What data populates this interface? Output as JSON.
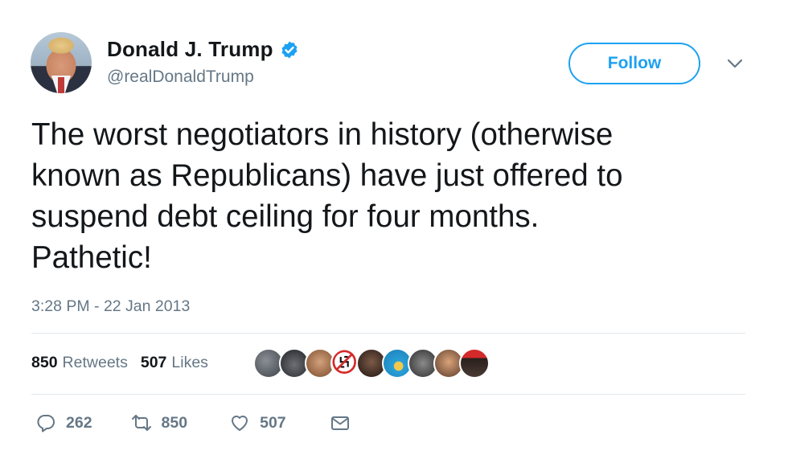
{
  "author": {
    "name": "Donald J. Trump",
    "handle": "@realDonaldTrump",
    "verified": true
  },
  "follow_label": "Follow",
  "tweet": {
    "text": "The worst negotiators in history (otherwise\nknown as Republicans) have just offered to\nsuspend debt ceiling for four months.\nPathetic!",
    "timestamp": "3:28 PM - 22 Jan 2013"
  },
  "stats": {
    "retweets_count": "850",
    "retweets_label": "Retweets",
    "likes_count": "507",
    "likes_label": "Likes"
  },
  "actions": {
    "replies": "262",
    "retweets": "850",
    "likes": "507"
  },
  "colors": {
    "accent": "#1da1f2",
    "text": "#14171a",
    "muted": "#657786",
    "divider": "#e1e8ed"
  },
  "liker_avatars": [
    "liker-avatar-1",
    "liker-avatar-2",
    "liker-avatar-3",
    "liker-avatar-4",
    "liker-avatar-5",
    "liker-avatar-6",
    "liker-avatar-7",
    "liker-avatar-8",
    "liker-avatar-9"
  ]
}
